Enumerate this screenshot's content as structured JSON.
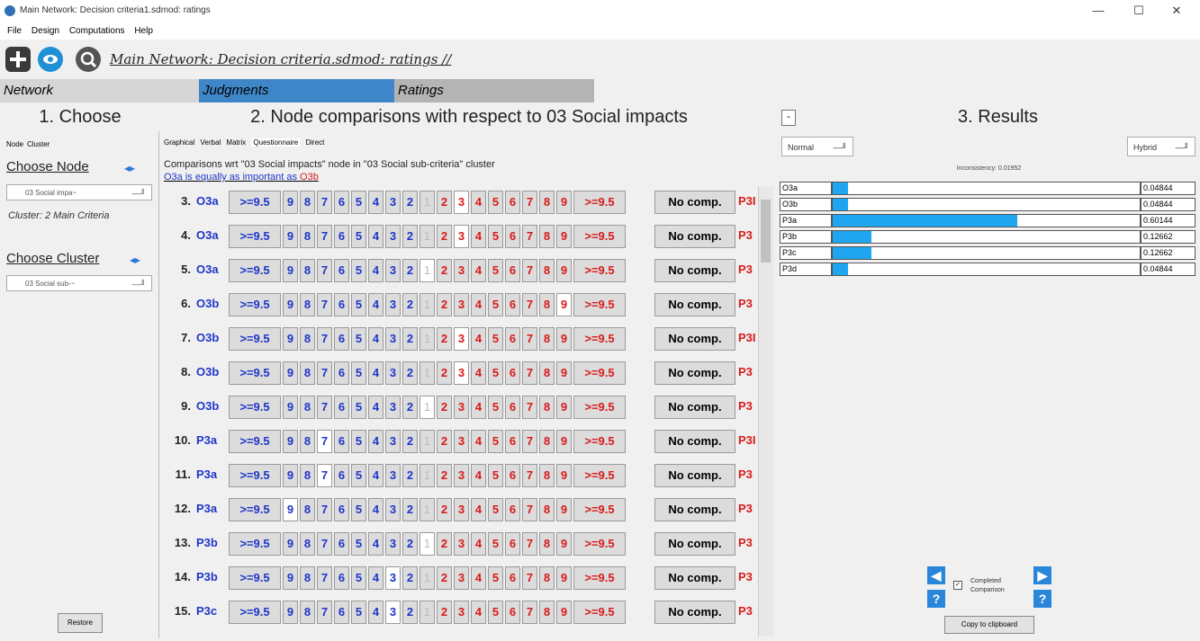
{
  "window": {
    "title": "Main Network: Decision criteria1.sdmod: ratings",
    "minimize": "—",
    "maximize": "☐",
    "close": "✕"
  },
  "menu": [
    "File",
    "Design",
    "Computations",
    "Help"
  ],
  "toolbar": {
    "path": "Main Network: Decision criteria.sdmod: ratings //"
  },
  "tabs": {
    "network": "Network",
    "judgments": "Judgments",
    "ratings": "Ratings"
  },
  "headers": {
    "choose": "1. Choose",
    "comparisons": "2. Node comparisons with respect to 03 Social impacts",
    "results": "3. Results",
    "collapse": "-"
  },
  "left": {
    "tab_node": "Node",
    "tab_cluster": "Cluster",
    "choose_node": "Choose Node",
    "node_select": "03 Social impa~",
    "cluster_label": "Cluster: 2 Main Criteria",
    "choose_cluster": "Choose Cluster",
    "cluster_select": "03 Social sub-~",
    "restore": "Restore"
  },
  "middle": {
    "subtabs": [
      "Graphical",
      "Verbal",
      "Matrix",
      "Questionnaire",
      "Direct"
    ],
    "comp_title": "Comparisons wrt \"03 Social impacts\" node in \"03 Social sub-criteria\" cluster",
    "status_left": "O3a",
    "status_mid": " is equally as important as ",
    "status_right": "O3b",
    "scale_left": [
      ">=9.5",
      "9",
      "8",
      "7",
      "6",
      "5",
      "4",
      "3",
      "2"
    ],
    "scale_one": "1",
    "scale_right": [
      "2",
      "3",
      "4",
      "5",
      "6",
      "7",
      "8",
      "9",
      ">=9.5"
    ],
    "no_comp": "No comp.",
    "rows": [
      {
        "num": "3.",
        "left": "O3a",
        "right": "P3I",
        "selected": "R3"
      },
      {
        "num": "4.",
        "left": "O3a",
        "right": "P3",
        "selected": "R3"
      },
      {
        "num": "5.",
        "left": "O3a",
        "right": "P3",
        "selected": "1"
      },
      {
        "num": "6.",
        "left": "O3b",
        "right": "P3",
        "selected": "R9"
      },
      {
        "num": "7.",
        "left": "O3b",
        "right": "P3I",
        "selected": "R3"
      },
      {
        "num": "8.",
        "left": "O3b",
        "right": "P3",
        "selected": "R3"
      },
      {
        "num": "9.",
        "left": "O3b",
        "right": "P3",
        "selected": "1"
      },
      {
        "num": "10.",
        "left": "P3a",
        "right": "P3I",
        "selected": "L7"
      },
      {
        "num": "11.",
        "left": "P3a",
        "right": "P3",
        "selected": "L7"
      },
      {
        "num": "12.",
        "left": "P3a",
        "right": "P3",
        "selected": "L9"
      },
      {
        "num": "13.",
        "left": "P3b",
        "right": "P3",
        "selected": "1"
      },
      {
        "num": "14.",
        "left": "P3b",
        "right": "P3",
        "selected": "L3"
      },
      {
        "num": "15.",
        "left": "P3c",
        "right": "P3",
        "selected": "L3"
      }
    ]
  },
  "right": {
    "normal": "Normal",
    "hybrid": "Hybrid",
    "inconsistency": "Inconsistency: 0.01952",
    "results": [
      {
        "name": "O3a",
        "value": "0.04844",
        "fraction": 0.0484
      },
      {
        "name": "O3b",
        "value": "0.04844",
        "fraction": 0.0484
      },
      {
        "name": "P3a",
        "value": "0.60144",
        "fraction": 0.6014
      },
      {
        "name": "P3b",
        "value": "0.12662",
        "fraction": 0.1266
      },
      {
        "name": "P3c",
        "value": "0.12662",
        "fraction": 0.1266
      },
      {
        "name": "P3d",
        "value": "0.04844",
        "fraction": 0.0484
      }
    ],
    "completed_line1": "Completed",
    "completed_line2": "Comparison",
    "copy": "Copy to clipboard",
    "accent": "#1ea6f0"
  },
  "colors": {
    "left_node": "#1f36c8",
    "right_node": "#d81b1b",
    "judgments_tab": "#3f86c8",
    "ratings_tab": "#b4b4b4"
  }
}
